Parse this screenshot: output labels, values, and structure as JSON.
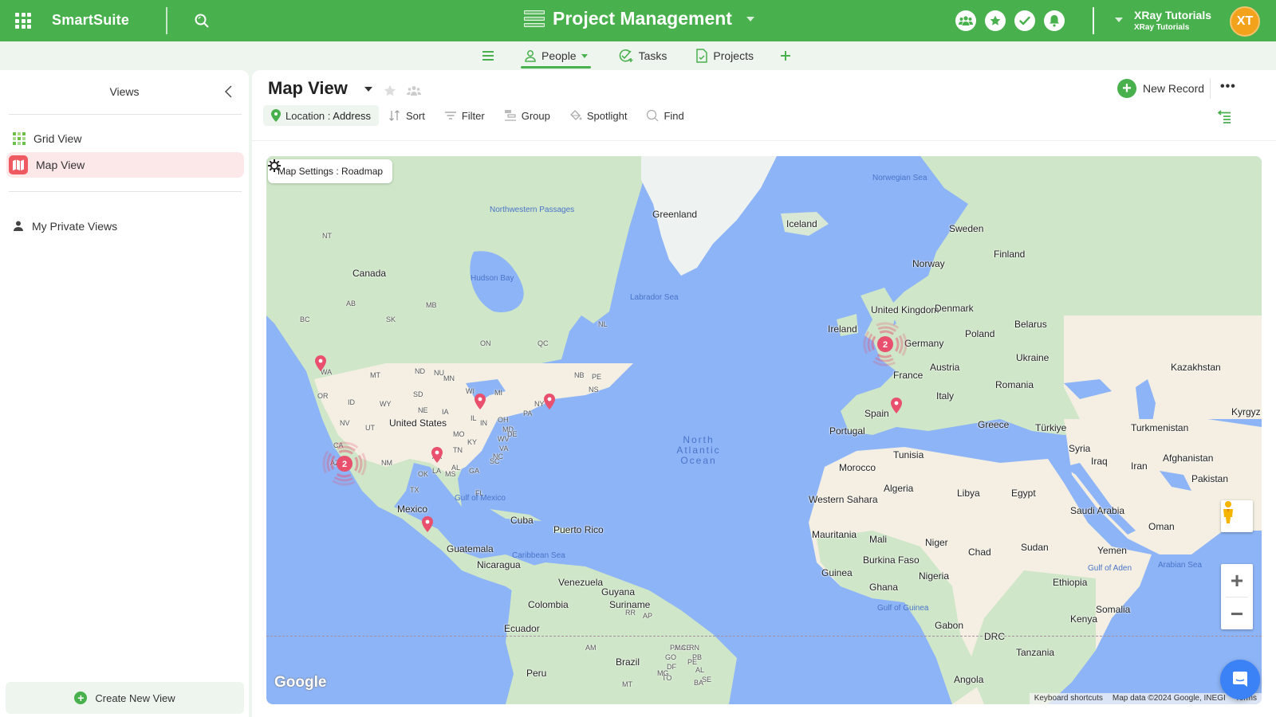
{
  "topbar": {
    "brand": "SmartSuite",
    "solution_title": "Project Management",
    "account_name": "XRay Tutorials",
    "account_sub": "XRay Tutorials",
    "avatar_initials": "XT",
    "icons": [
      "members-icon",
      "favorites-icon",
      "tasks-check-icon",
      "notifications-bell-icon"
    ]
  },
  "tabs": {
    "items": [
      {
        "label": "People",
        "icon": "person-icon",
        "active": true
      },
      {
        "label": "Tasks",
        "icon": "task-check-icon",
        "active": false
      },
      {
        "label": "Projects",
        "icon": "document-check-icon",
        "active": false
      }
    ]
  },
  "sidebar": {
    "title": "Views",
    "items": [
      {
        "label": "Grid View",
        "icon": "grid-icon",
        "active": false
      },
      {
        "label": "Map View",
        "icon": "map-icon",
        "active": true
      }
    ],
    "private_views_label": "My Private Views",
    "create_label": "Create New View"
  },
  "view": {
    "title": "Map View",
    "new_record_label": "New Record",
    "more_label": "•••",
    "toolbar": {
      "location_prefix": "Location : ",
      "location_field": "Address",
      "sort": "Sort",
      "filter": "Filter",
      "group": "Group",
      "spotlight": "Spotlight",
      "find": "Find"
    }
  },
  "map": {
    "settings_label": "Map Settings : Roadmap",
    "google_logo": "Google",
    "attribution": {
      "shortcuts": "Keyboard shortcuts",
      "map_data": "Map data ©2024 Google, INEGI",
      "terms": "Terms"
    },
    "markers": [
      {
        "type": "pin",
        "location": "Seattle, WA"
      },
      {
        "type": "cluster",
        "count": "2",
        "location": "Southern California"
      },
      {
        "type": "pin",
        "location": "Chicago, IL"
      },
      {
        "type": "pin",
        "location": "Boston area"
      },
      {
        "type": "pin",
        "location": "Dallas, TX"
      },
      {
        "type": "pin",
        "location": "Mexico City"
      },
      {
        "type": "cluster",
        "count": "2",
        "location": "United Kingdom"
      },
      {
        "type": "pin",
        "location": "Southern France"
      }
    ],
    "marker_color": "#e8506e",
    "labels": {
      "countries": [
        "Greenland",
        "Iceland",
        "Canada",
        "United States",
        "Mexico",
        "Cuba",
        "Puerto Rico",
        "Guatemala",
        "Nicaragua",
        "Venezuela",
        "Guyana",
        "Suriname",
        "Colombia",
        "Ecuador",
        "Peru",
        "Brazil",
        "Sweden",
        "Finland",
        "Norway",
        "United Kingdom",
        "Ireland",
        "Denmark",
        "Belarus",
        "Poland",
        "Germany",
        "Ukraine",
        "France",
        "Austria",
        "Romania",
        "Kazakhstan",
        "Italy",
        "Spain",
        "Portugal",
        "Greece",
        "Türkiye",
        "Turkmenistan",
        "Kyrgyz",
        "Syria",
        "Iraq",
        "Iran",
        "Afghanistan",
        "Pakistan",
        "Tunisia",
        "Morocco",
        "Algeria",
        "Libya",
        "Egypt",
        "Western Sahara",
        "Saudi Arabia",
        "Oman",
        "Mauritania",
        "Mali",
        "Niger",
        "Chad",
        "Sudan",
        "Yemen",
        "Burkina Faso",
        "Guinea",
        "Ghana",
        "Nigeria",
        "Ethiopia",
        "Somalia",
        "Kenya",
        "Gabon",
        "DRC",
        "Tanzania",
        "Angola"
      ],
      "regions": [
        "NU",
        "NT",
        "AB",
        "SK",
        "MB",
        "BC",
        "ON",
        "QC",
        "NL",
        "NB",
        "PE",
        "NS",
        "WA",
        "MT",
        "ND",
        "MN",
        "OR",
        "ID",
        "WY",
        "SD",
        "WI",
        "MI",
        "NY",
        "IA",
        "NE",
        "IL",
        "IN",
        "OH",
        "PA",
        "NV",
        "UT",
        "CA",
        "MO",
        "KY",
        "WV",
        "MD",
        "DE",
        "VA",
        "AZ",
        "NM",
        "OK",
        "AR",
        "TN",
        "NC",
        "MS",
        "AL",
        "GA",
        "SC",
        "TX",
        "LA",
        "FL",
        "RR",
        "AP",
        "AM",
        "PA",
        "MA",
        "CE",
        "RN",
        "PB",
        "PE",
        "AL",
        "SE",
        "MT",
        "TO",
        "BA",
        "GO",
        "DF",
        "MG"
      ],
      "water": [
        "Norwegian Sea",
        "Northwestern Passages",
        "Hudson Bay",
        "Labrador Sea",
        "Gulf of Mexico",
        "Caribbean Sea",
        "Gulf of Guinea",
        "Gulf of Aden",
        "Arabian Sea"
      ],
      "ocean": "North Atlantic Ocean"
    }
  }
}
